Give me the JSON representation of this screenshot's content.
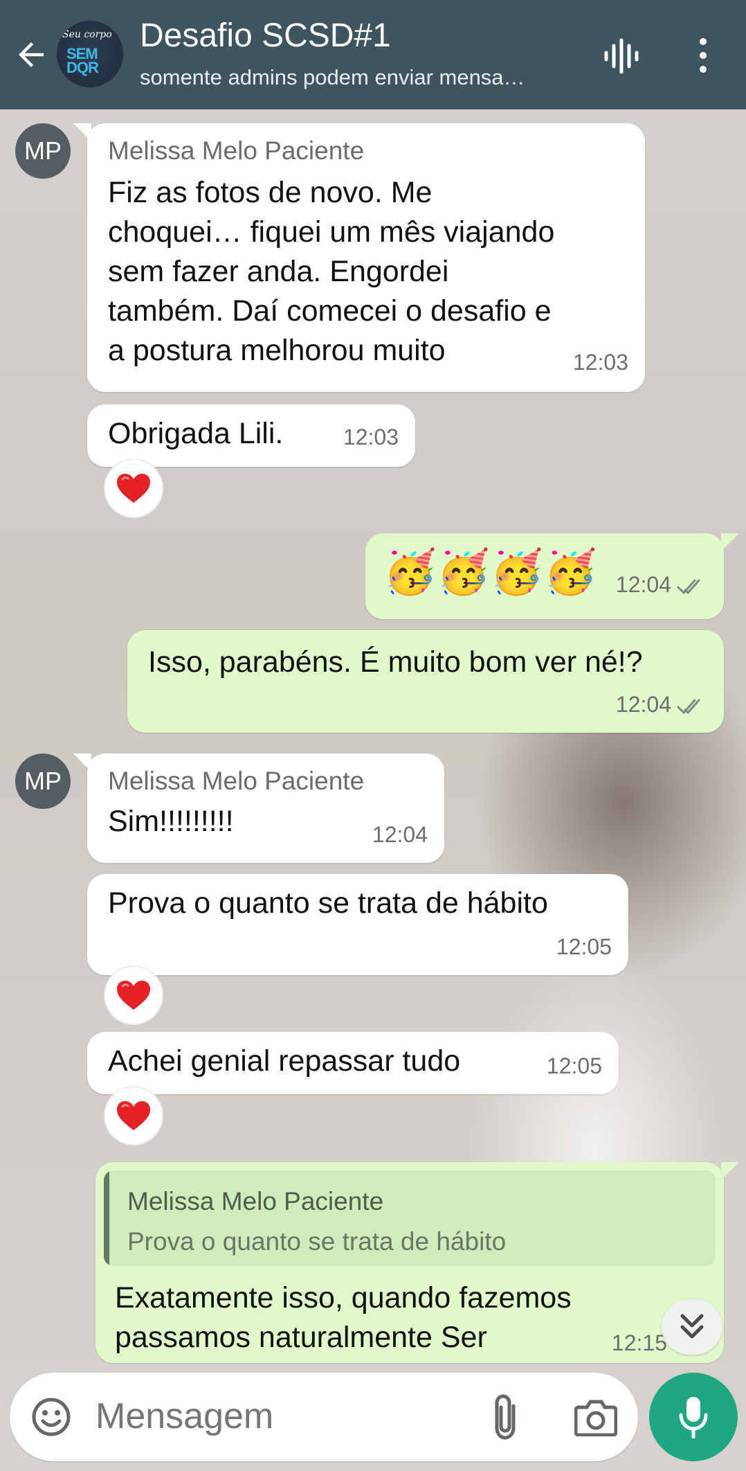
{
  "header": {
    "title": "Desafio SCSD#1",
    "subtitle": "somente admins podem enviar mensa…",
    "avatar_logo_script": "Seu corpo",
    "avatar_logo_main": "SEM DQR"
  },
  "messages": [
    {
      "id": "m1",
      "direction": "in",
      "sender_initials": "MP",
      "sender": "Melissa Melo Paciente",
      "lines": [
        "Fiz as fotos de novo. Me",
        "choquei… fiquei um mês viajando",
        "sem fazer anda. Engordei",
        "também. Daí comecei o desafio e",
        "a postura melhorou muito"
      ],
      "time": "12:03"
    },
    {
      "id": "m2",
      "direction": "in",
      "text": "Obrigada Lili.",
      "time": "12:03",
      "reaction": "❤️"
    },
    {
      "id": "m3",
      "direction": "out",
      "text": "🥳🥳🥳🥳",
      "time": "12:04",
      "status": "read"
    },
    {
      "id": "m4",
      "direction": "out",
      "text": "Isso, parabéns. É muito bom ver né!?",
      "time": "12:04",
      "status": "read"
    },
    {
      "id": "m5",
      "direction": "in",
      "sender_initials": "MP",
      "sender": "Melissa Melo Paciente",
      "text": "Sim!!!!!!!!!",
      "time": "12:04"
    },
    {
      "id": "m6",
      "direction": "in",
      "text": "Prova o quanto se trata de hábito",
      "time": "12:05",
      "reaction": "❤️"
    },
    {
      "id": "m7",
      "direction": "in",
      "text": "Achei genial repassar tudo",
      "time": "12:05",
      "reaction": "❤️"
    },
    {
      "id": "m8",
      "direction": "out",
      "quote_sender": "Melissa Melo Paciente",
      "quote_text": "Prova o quanto se trata de hábito",
      "lines": [
        "Exatamente isso, quando fazemos",
        "passamos naturalmente Ser"
      ],
      "time": "12:15"
    }
  ],
  "composer": {
    "placeholder": "Mensagem"
  },
  "colors": {
    "header_bg": "#3f545f",
    "incoming_bubble": "#ffffff",
    "outgoing_bubble": "#e1f8cb",
    "mic_button": "#1fa782",
    "tick_color": "#7a8a7f"
  },
  "icons": {
    "back": "arrow-left-icon",
    "voice_call": "audio-waveform-icon",
    "menu": "more-vertical-icon",
    "emoji": "emoji-icon",
    "attach": "paperclip-icon",
    "camera": "camera-icon",
    "mic": "microphone-icon",
    "scroll_down": "double-chevron-down-icon"
  }
}
